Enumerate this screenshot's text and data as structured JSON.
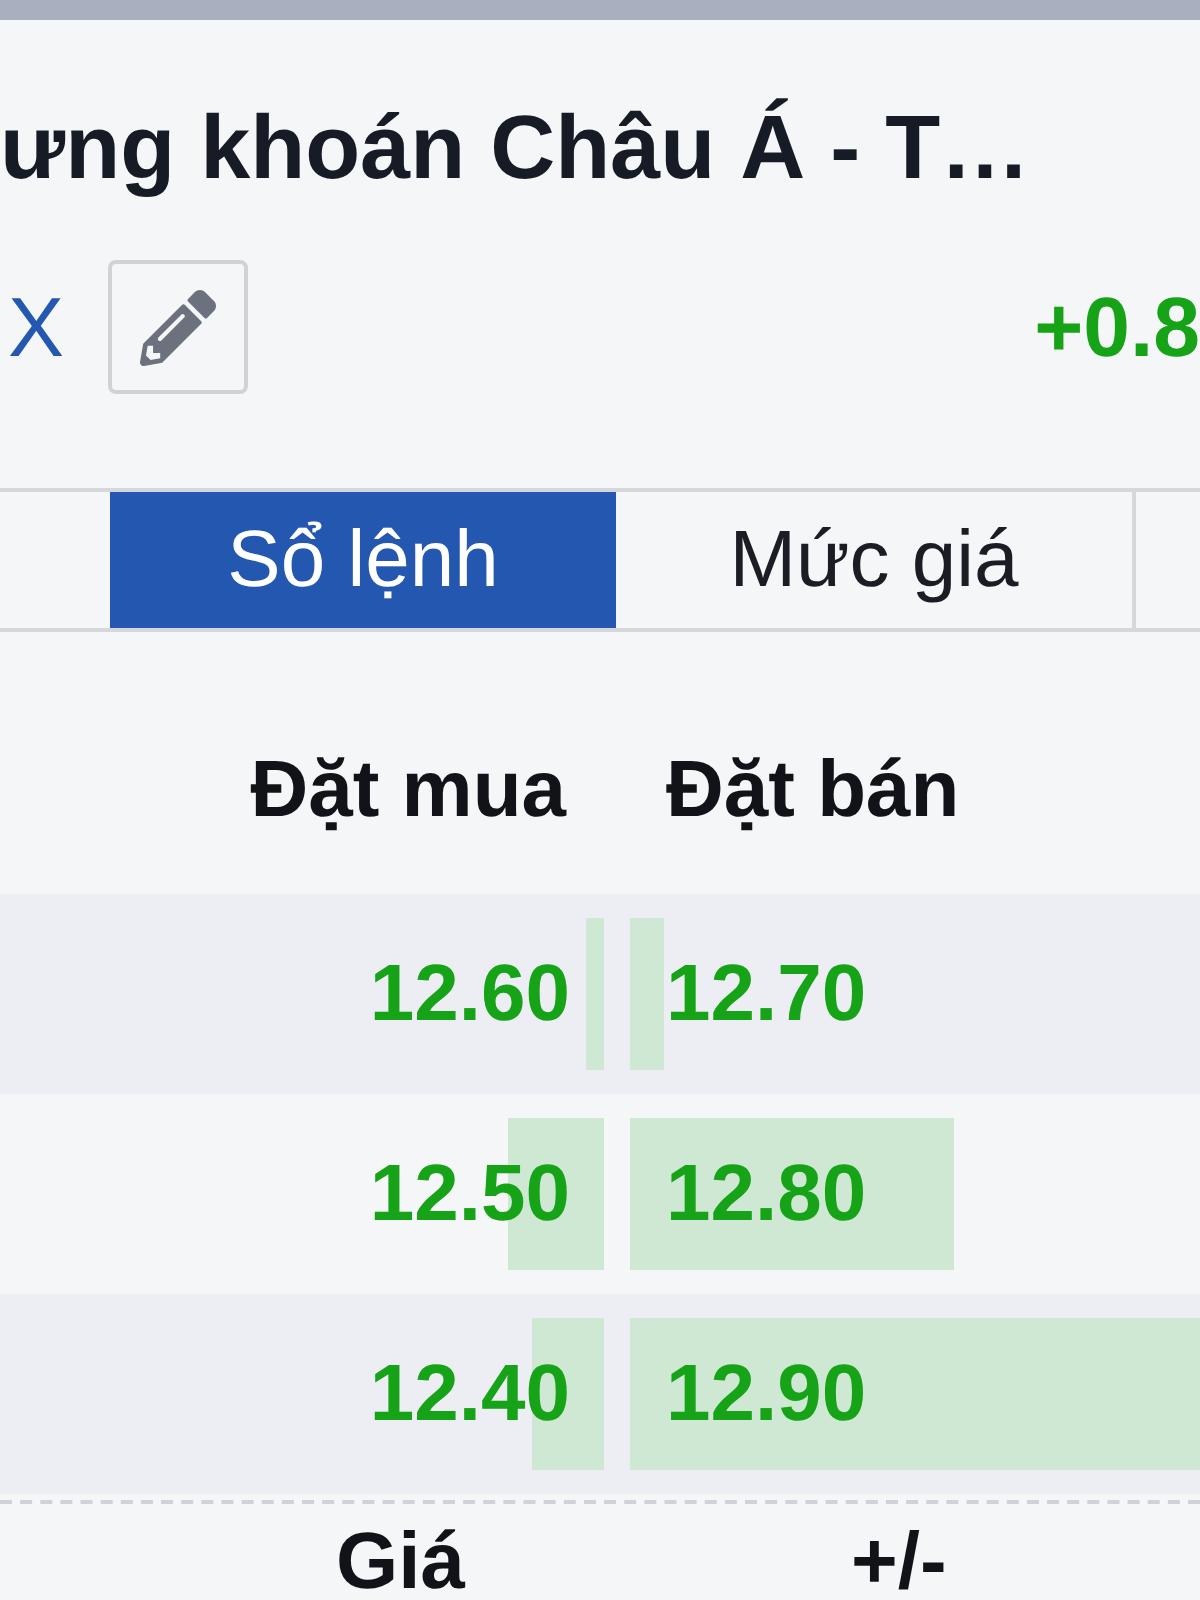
{
  "header": {
    "title": "ưng khoán Châu Á - T…",
    "symbol": "X",
    "change": "+0.8"
  },
  "tabs": [
    {
      "label": "Sổ lệnh",
      "selected": true
    },
    {
      "label": "Mức giá",
      "selected": false
    }
  ],
  "order_book": {
    "columns": [
      "Đặt mua",
      "Đặt bán"
    ],
    "rows": [
      {
        "bid": {
          "price": "12.60",
          "level": 0.03
        },
        "ask": {
          "price": "12.70",
          "level": 0.06
        }
      },
      {
        "bid": {
          "price": "12.50",
          "level": 0.16
        },
        "ask": {
          "price": "12.80",
          "level": 0.57
        }
      },
      {
        "bid": {
          "price": "12.40",
          "level": 0.12
        },
        "ask": {
          "price": "12.90",
          "level": 1
        }
      }
    ]
  },
  "next_table": {
    "columns": [
      "Giá",
      "+/-"
    ]
  }
}
